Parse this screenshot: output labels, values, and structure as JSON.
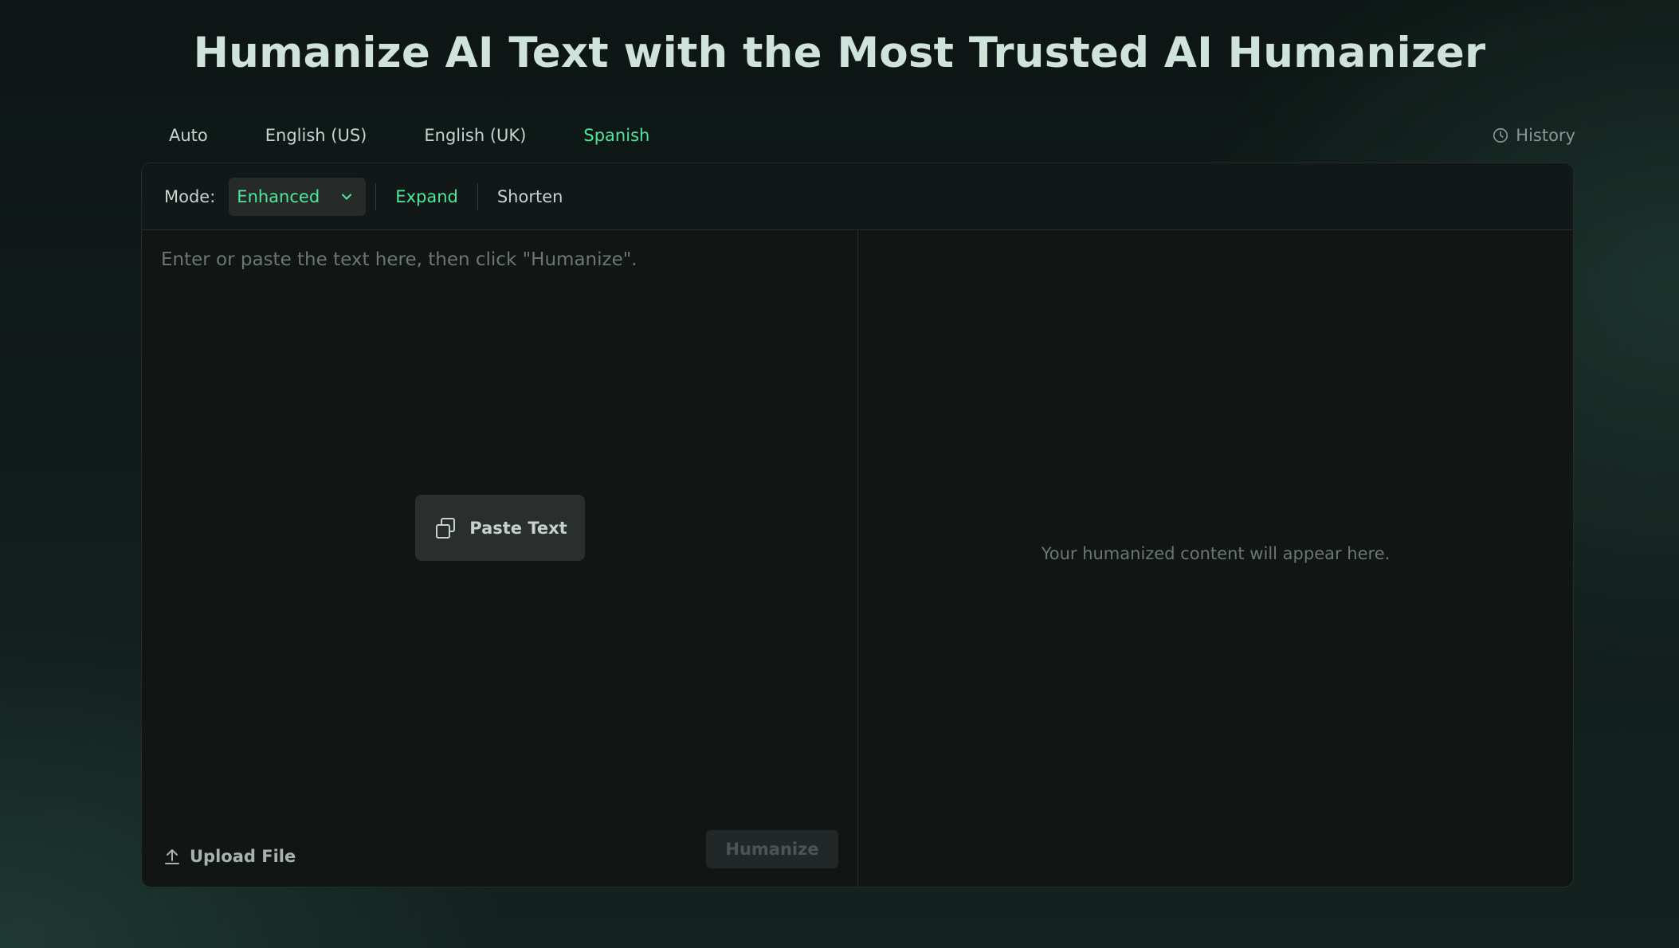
{
  "page": {
    "title": "Humanize AI Text with the Most Trusted AI Humanizer"
  },
  "language_tabs": [
    {
      "label": "Auto",
      "active": false
    },
    {
      "label": "English (US)",
      "active": false
    },
    {
      "label": "English (UK)",
      "active": false
    },
    {
      "label": "Spanish",
      "active": true
    }
  ],
  "history": {
    "label": "History",
    "icon": "clock-icon"
  },
  "toolbar": {
    "mode_label": "Mode:",
    "mode_value": "Enhanced",
    "expand_label": "Expand",
    "shorten_label": "Shorten"
  },
  "input": {
    "placeholder": "Enter or paste the text here, then click \"Humanize\".",
    "value": "",
    "paste_label": "Paste Text",
    "upload_label": "Upload File",
    "humanize_label": "Humanize"
  },
  "output": {
    "placeholder": "Your humanized content will appear here."
  },
  "colors": {
    "accent": "#4fe89a",
    "background": "#0d1614",
    "panel": "#111615"
  }
}
